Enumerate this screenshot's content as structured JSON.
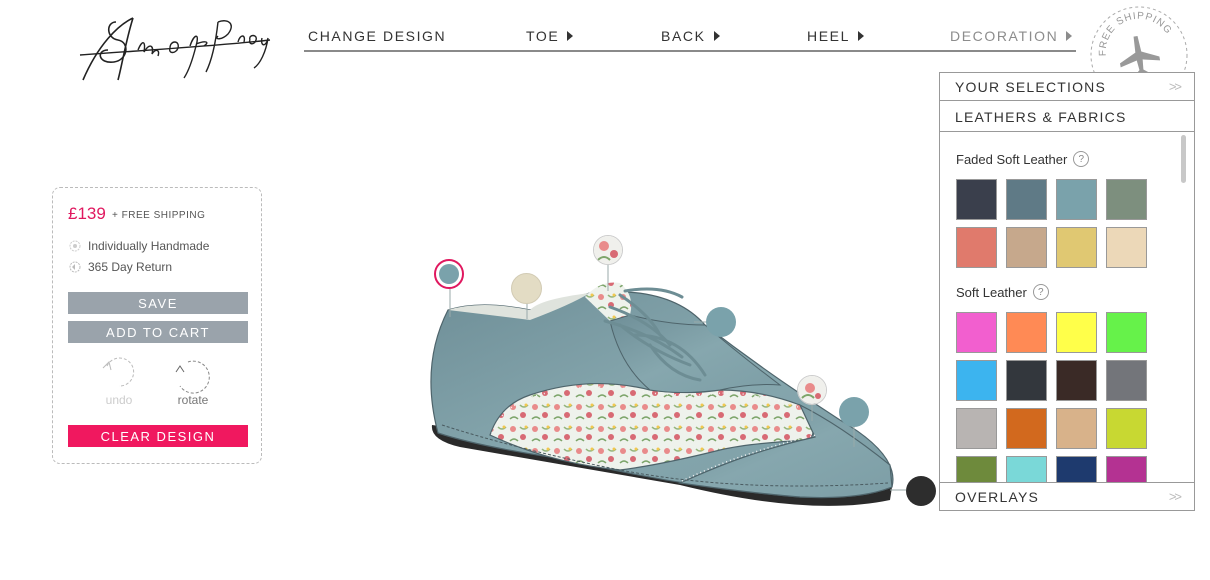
{
  "logo": {
    "text": "Shoes of Prey"
  },
  "nav": {
    "items": [
      {
        "label": "CHANGE DESIGN",
        "arrow": false,
        "dim": false
      },
      {
        "label": "TOE",
        "arrow": true,
        "dim": false
      },
      {
        "label": "BACK",
        "arrow": true,
        "dim": false
      },
      {
        "label": "HEEL",
        "arrow": true,
        "dim": false
      },
      {
        "label": "DECORATION",
        "arrow": true,
        "dim": true
      }
    ]
  },
  "badge": {
    "text": "FREE SHIPPING",
    "icon": "airplane-icon"
  },
  "product": {
    "price": "£139",
    "price_note": "+ FREE SHIPPING",
    "features": [
      "Individually Handmade",
      "365 Day Return"
    ],
    "save_label": "SAVE",
    "add_to_cart_label": "ADD TO CART",
    "undo_label": "undo",
    "rotate_label": "rotate",
    "clear_label": "CLEAR DESIGN",
    "accent": "#f0185f"
  },
  "panel": {
    "your_selections": "YOUR SELECTIONS",
    "leathers_fabrics": "LEATHERS & FABRICS",
    "overlays": "OVERLAYS",
    "groups": [
      {
        "name": "Faded Soft Leather",
        "colors": [
          "#3a3f4c",
          "#5f7a86",
          "#7aa2ab",
          "#7d8f7e",
          "#e07a6c",
          "#c6a88c",
          "#e0c872",
          "#ecd8b8"
        ]
      },
      {
        "name": "Soft Leather",
        "colors": [
          "#f25fcf",
          "#ff8a55",
          "#ffff4a",
          "#66f24a",
          "#3cb4ef",
          "#33373d",
          "#3a2a26",
          "#73757a",
          "#b8b4b2",
          "#d2691e",
          "#d8b28a",
          "#c8d832",
          "#6e8a3c",
          "#7ad8d8",
          "#1e3a6e",
          "#b43292"
        ]
      }
    ]
  },
  "shoe": {
    "hotspots": [
      {
        "color": "#7aa2ab",
        "selected": true
      },
      {
        "color": "#e3dcc4",
        "selected": false
      },
      {
        "color": "pattern-floral",
        "selected": false
      },
      {
        "color": "#7aa2ab",
        "selected": false
      },
      {
        "color": "pattern-floral",
        "selected": false
      },
      {
        "color": "#7aa2ab",
        "selected": false
      },
      {
        "color": "#2d2d2d",
        "selected": false
      }
    ]
  }
}
